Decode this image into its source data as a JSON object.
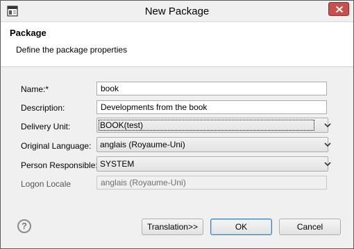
{
  "window": {
    "title": "New Package"
  },
  "header": {
    "title": "Package",
    "description": "Define the package properties"
  },
  "form": {
    "name": {
      "label": "Name:*",
      "value": "book"
    },
    "description": {
      "label": "Description:",
      "value": "Developments from the book"
    },
    "delivery_unit": {
      "label": "Delivery Unit:",
      "value": "BOOK(test)"
    },
    "original_language": {
      "label": "Original Language:",
      "value": "anglais (Royaume-Uni)"
    },
    "person_responsible": {
      "label": "Person Responsible:",
      "value": "SYSTEM"
    },
    "logon_locale": {
      "label": "Logon Locale",
      "value": "anglais (Royaume-Uni)"
    }
  },
  "footer": {
    "help_glyph": "?",
    "translation_label": "Translation>>",
    "ok_label": "OK",
    "cancel_label": "Cancel"
  },
  "icons": {
    "app": "app-window-icon",
    "close": "close-icon",
    "help": "help-icon",
    "dropdown": "chevron-down-icon"
  },
  "colors": {
    "close_button": "#c7504c",
    "default_button_border": "#3c7fb1"
  }
}
